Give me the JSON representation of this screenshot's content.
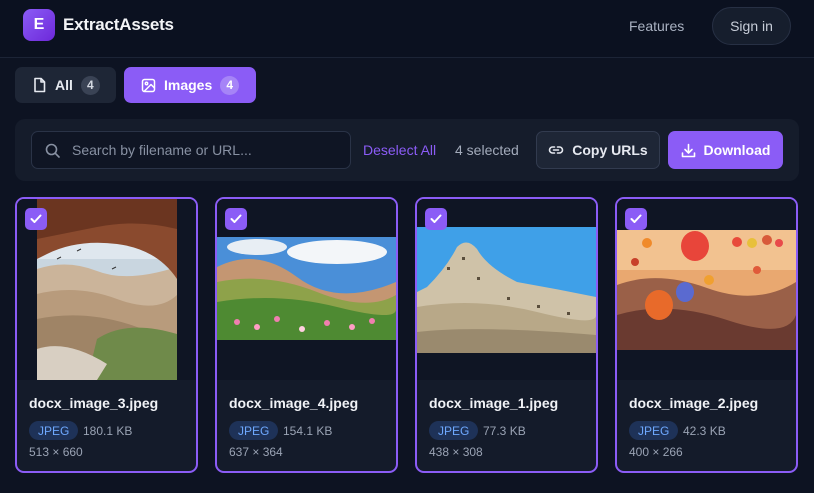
{
  "header": {
    "logo_letter": "E",
    "brand": "ExtractAssets",
    "nav_features": "Features",
    "signin": "Sign in"
  },
  "tabs": [
    {
      "label": "All",
      "count": "4",
      "icon": "file-icon",
      "active": false
    },
    {
      "label": "Images",
      "count": "4",
      "icon": "image-icon",
      "active": true
    }
  ],
  "toolbar": {
    "search_placeholder": "Search by filename or URL...",
    "search_value": "",
    "deselect_label": "Deselect All",
    "selected_text": "4 selected",
    "copy_label": "Copy URLs",
    "download_label": "Download"
  },
  "cards": [
    {
      "filename": "docx_image_3.jpeg",
      "type": "JPEG",
      "size": "180.1 KB",
      "dims": "513 × 660",
      "selected": true
    },
    {
      "filename": "docx_image_4.jpeg",
      "type": "JPEG",
      "size": "154.1 KB",
      "dims": "637 × 364",
      "selected": true
    },
    {
      "filename": "docx_image_1.jpeg",
      "type": "JPEG",
      "size": "77.3 KB",
      "dims": "438 × 308",
      "selected": true
    },
    {
      "filename": "docx_image_2.jpeg",
      "type": "JPEG",
      "size": "42.3 KB",
      "dims": "400 × 266",
      "selected": true
    }
  ],
  "colors": {
    "accent": "#8b5cf6",
    "background": "#0d1322",
    "badge_text": "#6ea8fe"
  }
}
